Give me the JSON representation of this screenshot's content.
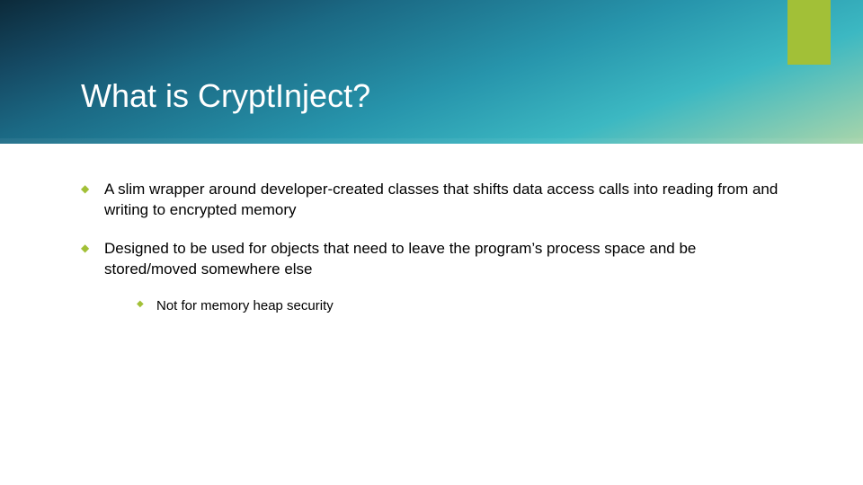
{
  "colors": {
    "accent_green": "#a2c037",
    "banner_start": "#0c2a3a",
    "banner_end": "#a9d5aa"
  },
  "slide": {
    "title": "What is CryptInject?",
    "bullets": [
      {
        "text": "A slim wrapper around developer-created classes that shifts data access calls into reading from and writing to encrypted memory",
        "sub": []
      },
      {
        "text": "Designed to be used for objects that need to leave the program’s process space and be stored/moved somewhere else",
        "sub": [
          {
            "text": "Not for memory heap security"
          }
        ]
      }
    ]
  }
}
